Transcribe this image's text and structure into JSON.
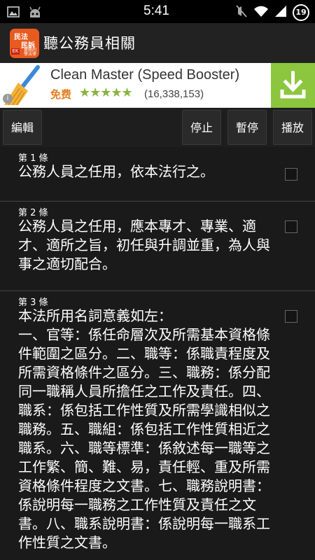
{
  "status_bar": {
    "time": "5:41",
    "battery": "19",
    "icons": [
      "picture-icon",
      "android-icon",
      "mute-icon",
      "wifi-icon",
      "signal-icon",
      "battery-icon"
    ]
  },
  "app": {
    "title": "聽公務員相關",
    "icon_text": [
      "民法",
      "民訴",
      "EK",
      "實務的學法律"
    ]
  },
  "ad": {
    "title": "Clean Master (Speed Booster)",
    "price": "免费",
    "stars": "★★★★★",
    "rating_count": "(16,338,153)",
    "info": "i",
    "colors": {
      "download_bg": "#8cc63f",
      "price": "#e67e22",
      "stars": "#8ab342"
    }
  },
  "toolbar": {
    "edit": "編輯",
    "stop": "停止",
    "pause": "暫停",
    "play": "播放"
  },
  "articles": [
    {
      "no": "第 1 條",
      "text": "公務人員之任用，依本法行之。"
    },
    {
      "no": "第 2 條",
      "text": "公務人員之任用，應本專才、專業、適才、適所之旨，初任與升調並重，為人與事之適切配合。"
    },
    {
      "no": "第 3 條",
      "text": "本法所用名詞意義如左：\n一、官等：係任命層次及所需基本資格條件範圍之區分。二、職等：係職責程度及所需資格條件之區分。三、職務：係分配同一職稱人員所擔任之工作及責任。四、職系：係包括工作性質及所需學識相似之職務。五、職組：係包括工作性質相近之職系。六、職等標準：係敘述每一職等之工作繁、簡、難、易，責任輕、重及所需資格條件程度之文書。七、職務說明書：係說明每一職務之工作性質及責任之文書。八、職系說明書：係說明每一職系工作性質之文書。"
    }
  ]
}
